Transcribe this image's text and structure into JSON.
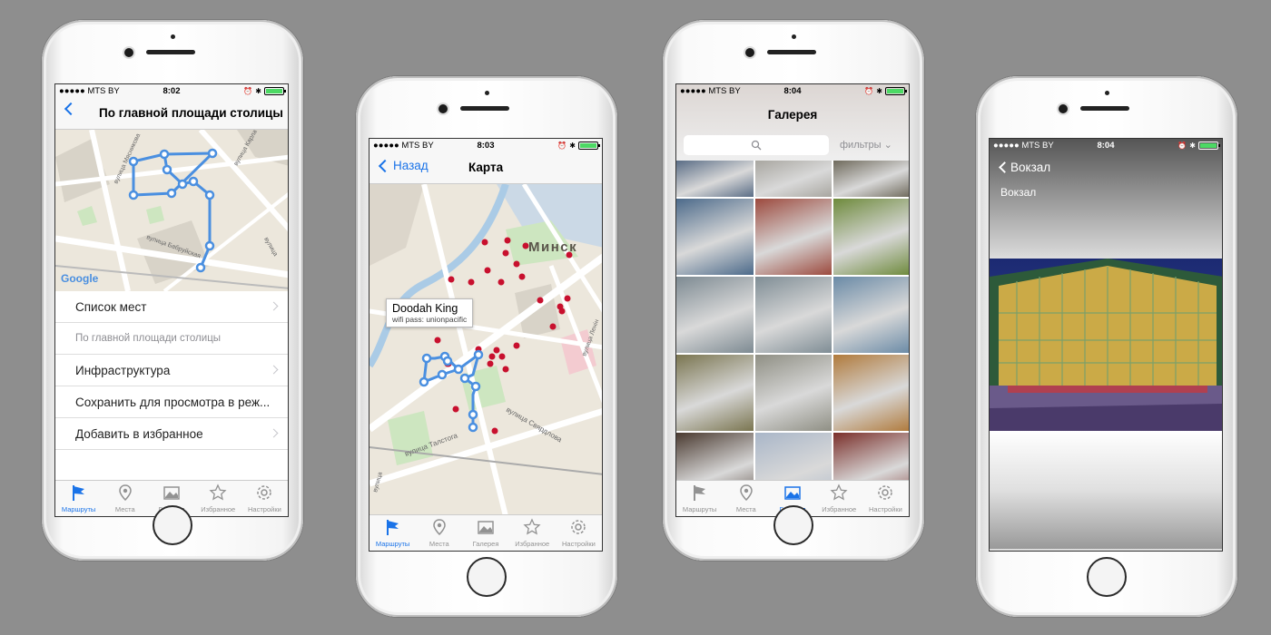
{
  "colors": {
    "accent": "#1a73e8",
    "route": "#4a8fe0",
    "poi": "#c8102e",
    "battery": "#4cd964"
  },
  "status": {
    "carrier": "●●●●● MTS BY",
    "times": [
      "8:02",
      "8:03",
      "8:04",
      "8:04"
    ]
  },
  "tabs": [
    {
      "label": "Маршруты",
      "icon": "flag-icon"
    },
    {
      "label": "Места",
      "icon": "pin-icon"
    },
    {
      "label": "Галерея",
      "icon": "gallery-icon"
    },
    {
      "label": "Избранное",
      "icon": "star-icon"
    },
    {
      "label": "Настройки",
      "icon": "gear-icon"
    }
  ],
  "screen1": {
    "title": "По главной площади столицы",
    "map_logo": "Google",
    "streets": [
      "вулица Карла Ма",
      "вулица Мясникова",
      "вулица Бабруйская",
      "вулица",
      "пр"
    ],
    "list": [
      {
        "label": "Список мест",
        "arrow": true
      },
      {
        "label": "По главной площади столицы",
        "arrow": false,
        "sub": true
      },
      {
        "label": "Инфраструктура",
        "arrow": true
      },
      {
        "label": "Сохранить для просмотра в реж...",
        "arrow": false
      },
      {
        "label": "Добавить в избранное",
        "arrow": true
      }
    ]
  },
  "screen2": {
    "back": "Назад",
    "title": "Карта",
    "city": "Минск",
    "callout": {
      "title": "Doodah King",
      "subtitle": "wifi pass: unionpacific"
    },
    "streets": [
      "вулица Свярдлова",
      "вулица Талстога",
      "вулица Ленін",
      "вулица"
    ]
  },
  "screen3": {
    "title": "Галерея",
    "filters": "фильтры",
    "photos": [
      "#5a6d86",
      "#a8a6a0",
      "#6f6a5c",
      "#4c6a8a",
      "#9c4a3e",
      "#6e8a3c",
      "#7d8a92",
      "#7f8d95",
      "#6a8aa6",
      "#7a7550",
      "#8f8f84",
      "#b07a3c",
      "#4a3a30",
      "#a9b6c8",
      "#7a2f2a"
    ]
  },
  "screen4": {
    "back": "Вокзал",
    "subtitle": "Вокзал"
  }
}
